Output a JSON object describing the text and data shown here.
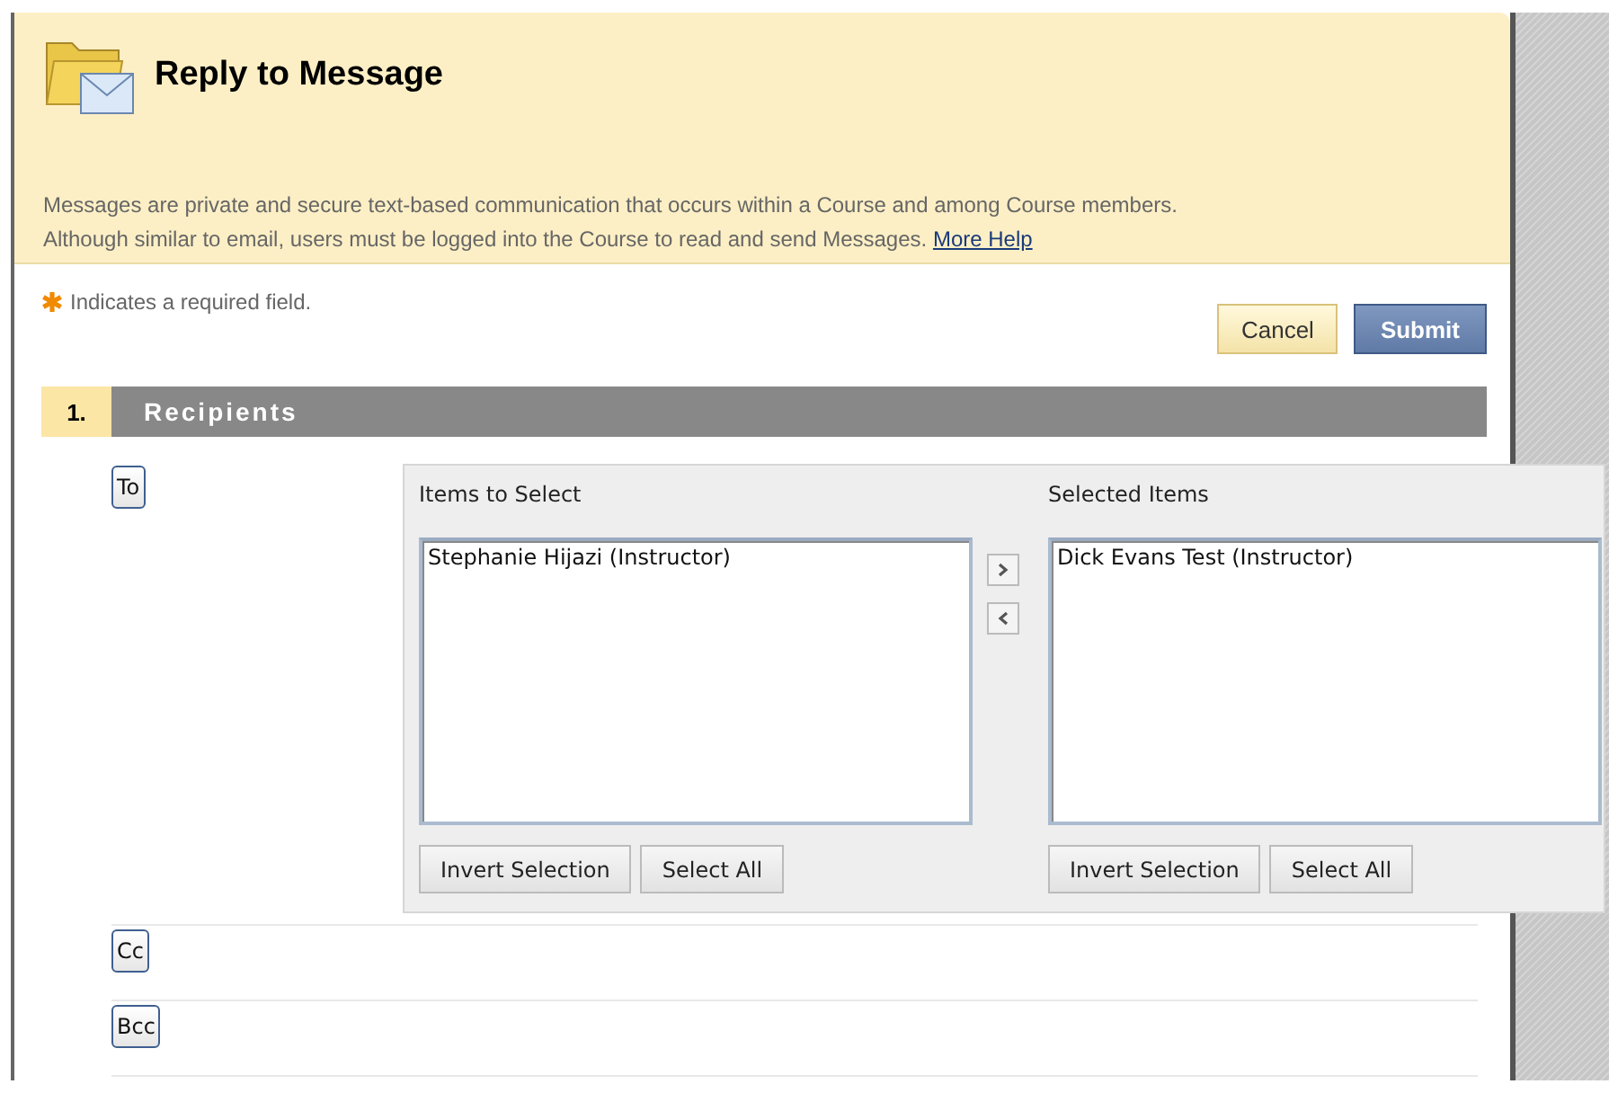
{
  "page": {
    "title": "Reply to Message",
    "description_lines": [
      "Messages are private and secure text-based communication that occurs within a Course and among Course members.",
      "Although similar to email, users must be logged into the Course to read and send Messages."
    ],
    "help_link": "More Help"
  },
  "required_note": "Indicates a required field.",
  "buttons": [
    {
      "label": "Cancel",
      "kind": "secondary"
    },
    {
      "label": "Submit",
      "kind": "primary"
    }
  ],
  "section": {
    "number": "1.",
    "title": "Recipients"
  },
  "recipients": [
    {
      "label": "To",
      "picker": {
        "lists": [
          {
            "label": "Items to Select",
            "items": [
              "Stephanie Hijazi (Instructor)"
            ],
            "buttons": [
              "Invert Selection",
              "Select All"
            ]
          },
          {
            "label": "Selected Items",
            "items": [
              "Dick Evans Test (Instructor)"
            ],
            "buttons": [
              "Invert Selection",
              "Select All"
            ]
          }
        ]
      }
    },
    {
      "label": "Cc"
    },
    {
      "label": "Bcc"
    }
  ]
}
